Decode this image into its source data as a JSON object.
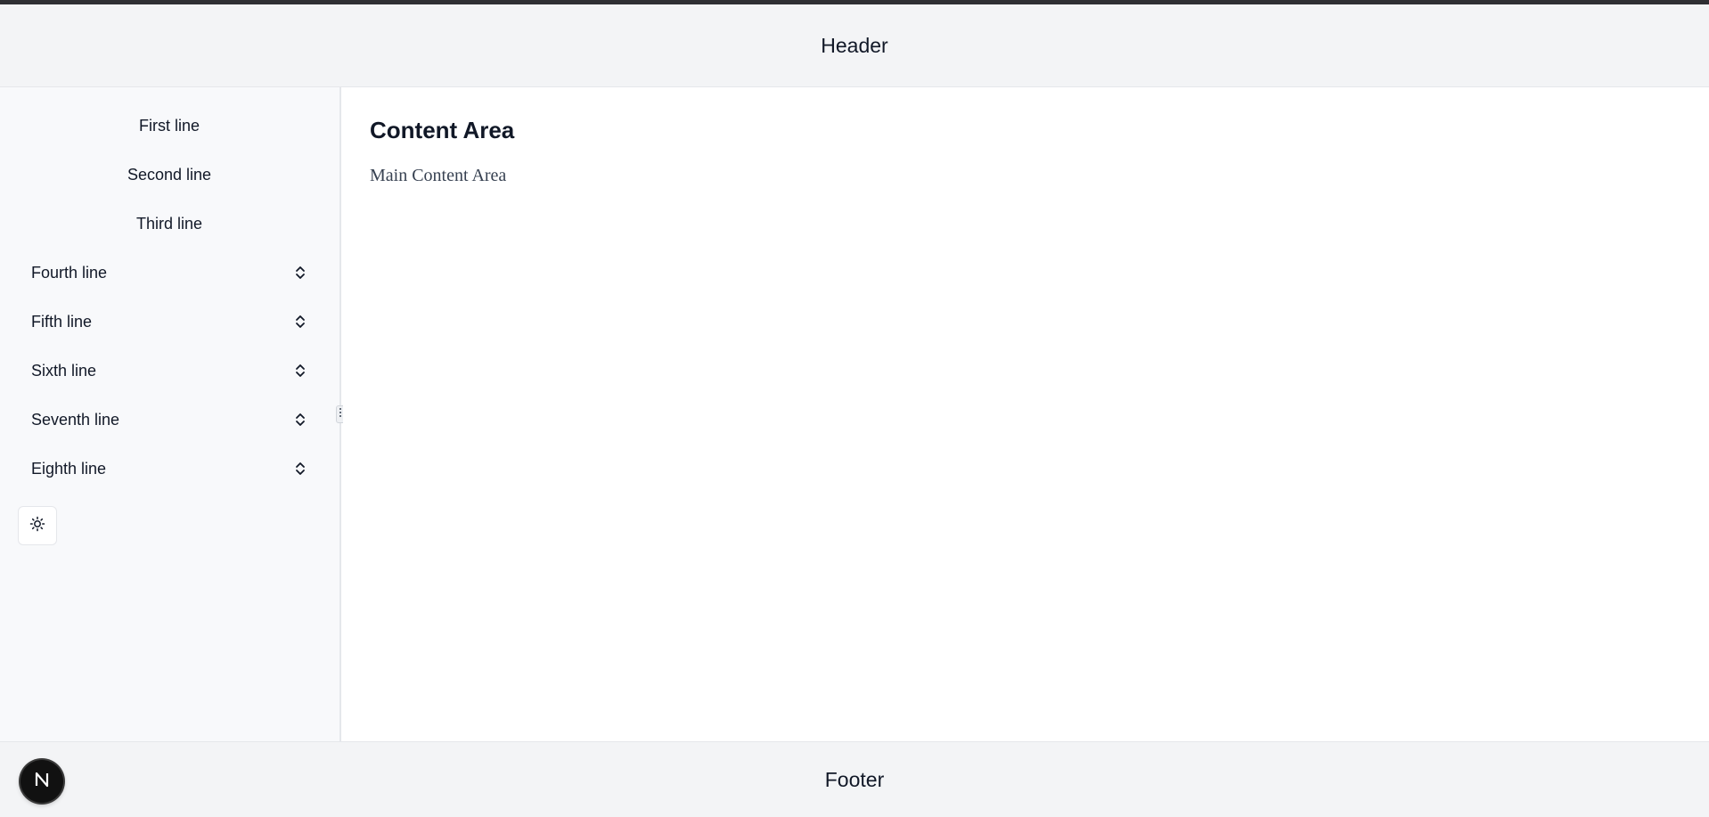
{
  "header": {
    "title": "Header"
  },
  "sidebar": {
    "items": [
      {
        "label": "First line",
        "icon": ""
      },
      {
        "label": "Second line",
        "icon": ""
      },
      {
        "label": "Third line",
        "icon": ""
      },
      {
        "label": "Fourth line",
        "icon": "chevron-up-down-icon"
      },
      {
        "label": "Fifth line",
        "icon": "chevron-up-down-icon"
      },
      {
        "label": "Sixth line",
        "icon": "chevron-up-down-icon"
      },
      {
        "label": "Seventh line",
        "icon": "chevron-up-down-icon"
      },
      {
        "label": "Eighth line",
        "icon": "chevron-up-down-icon"
      }
    ],
    "theme_toggle_icon": "sun-icon",
    "resize_handle_icon": "grip-vertical-icon"
  },
  "main": {
    "title": "Content Area",
    "text": "Main Content Area"
  },
  "footer": {
    "text": "Footer"
  },
  "badge": {
    "letter": "N"
  },
  "colors": {
    "topbar": "#2f2f33",
    "header_bg": "#f3f4f6",
    "sidebar_bg": "#f8f9fb",
    "content_bg": "#ffffff",
    "badge_bg": "#111111"
  }
}
